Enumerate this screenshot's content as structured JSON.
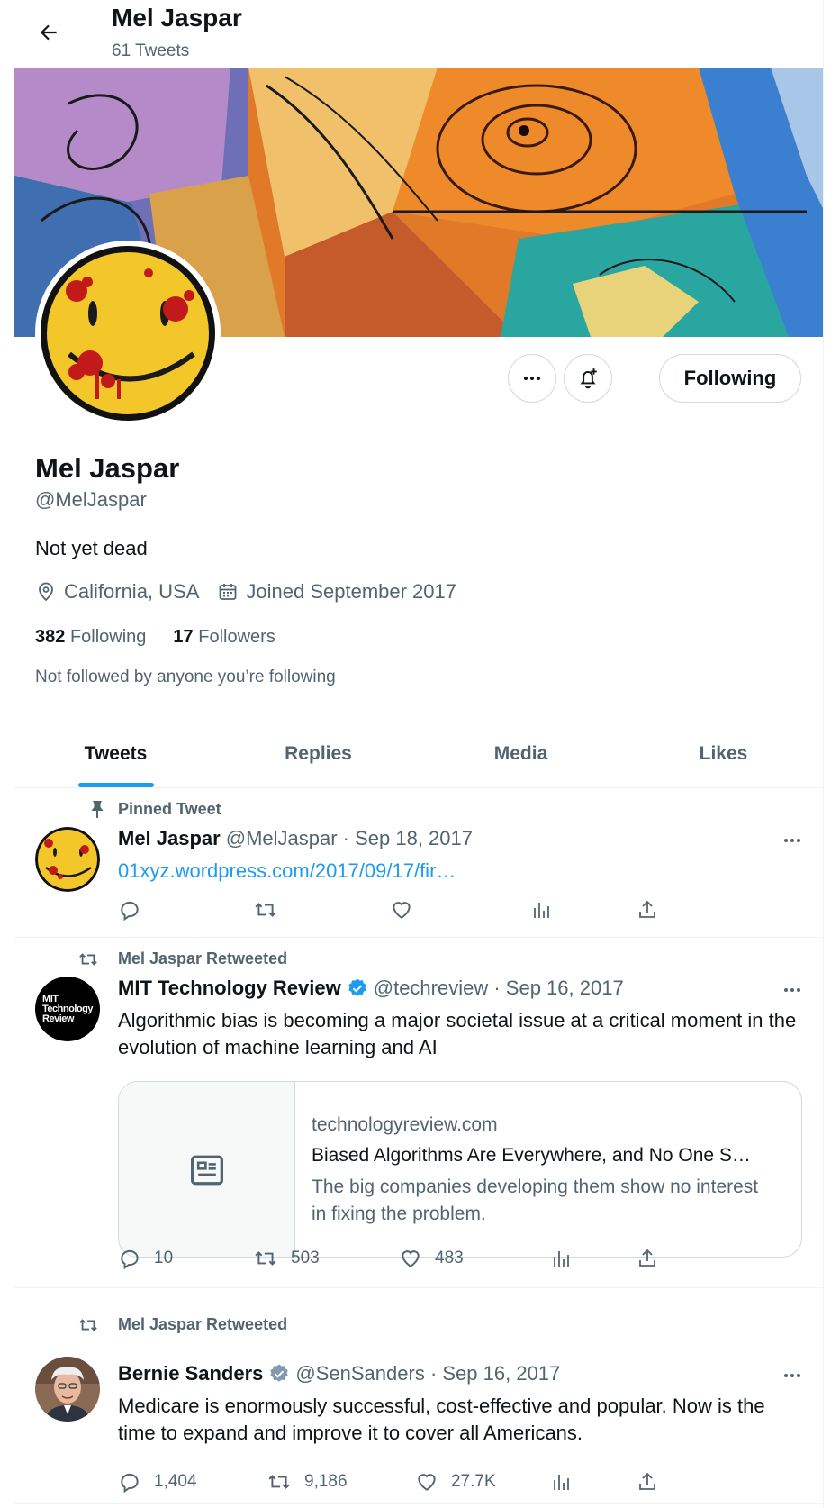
{
  "header": {
    "title": "Mel Jaspar",
    "tweet_count": "61 Tweets"
  },
  "profile": {
    "name": "Mel Jaspar",
    "handle": "@MelJaspar",
    "bio": "Not yet dead",
    "location": "California, USA",
    "joined": "Joined September 2017",
    "following_count": "382",
    "following_label": "Following",
    "followers_count": "17",
    "followers_label": "Followers",
    "not_followed": "Not followed by anyone you’re following",
    "follow_button": "Following"
  },
  "tabs": [
    {
      "label": "Tweets",
      "active": true
    },
    {
      "label": "Replies",
      "active": false
    },
    {
      "label": "Media",
      "active": false
    },
    {
      "label": "Likes",
      "active": false
    }
  ],
  "tweets": [
    {
      "context": "Pinned Tweet",
      "name": "Mel Jaspar",
      "meta": "@MelJaspar · Sep 18, 2017",
      "link": "01xyz.wordpress.com/2017/09/17/fir…",
      "verified": false,
      "replies": "",
      "retweets": "",
      "likes": ""
    },
    {
      "context": "Mel Jaspar Retweeted",
      "name": "MIT Technology Review",
      "meta": "@techreview · Sep 16, 2017",
      "text": "Algorithmic bias is becoming a major societal issue at a critical moment in the evolution of machine learning and AI",
      "avatar_text": [
        "MIT",
        "Technology",
        "Review"
      ],
      "verified": true,
      "verified_color": "#1d9bf0",
      "card": {
        "domain": "technologyreview.com",
        "title": "Biased Algorithms Are Everywhere, and No One S…",
        "description": "The big companies developing them show no interest in fixing the problem."
      },
      "replies": "10",
      "retweets": "503",
      "likes": "483"
    },
    {
      "context": "Mel Jaspar Retweeted",
      "name": "Bernie Sanders",
      "meta": "@SenSanders · Sep 16, 2017",
      "text": "Medicare is enormously successful, cost-effective and popular. Now is the time to expand and improve it to cover all Americans.",
      "verified": true,
      "verified_color": "#829aab",
      "replies": "1,404",
      "retweets": "9,186",
      "likes": "27.7K"
    }
  ],
  "colors": {
    "accent": "#1d9bf0",
    "secondary_text": "#536471",
    "border": "#cfd9de"
  }
}
